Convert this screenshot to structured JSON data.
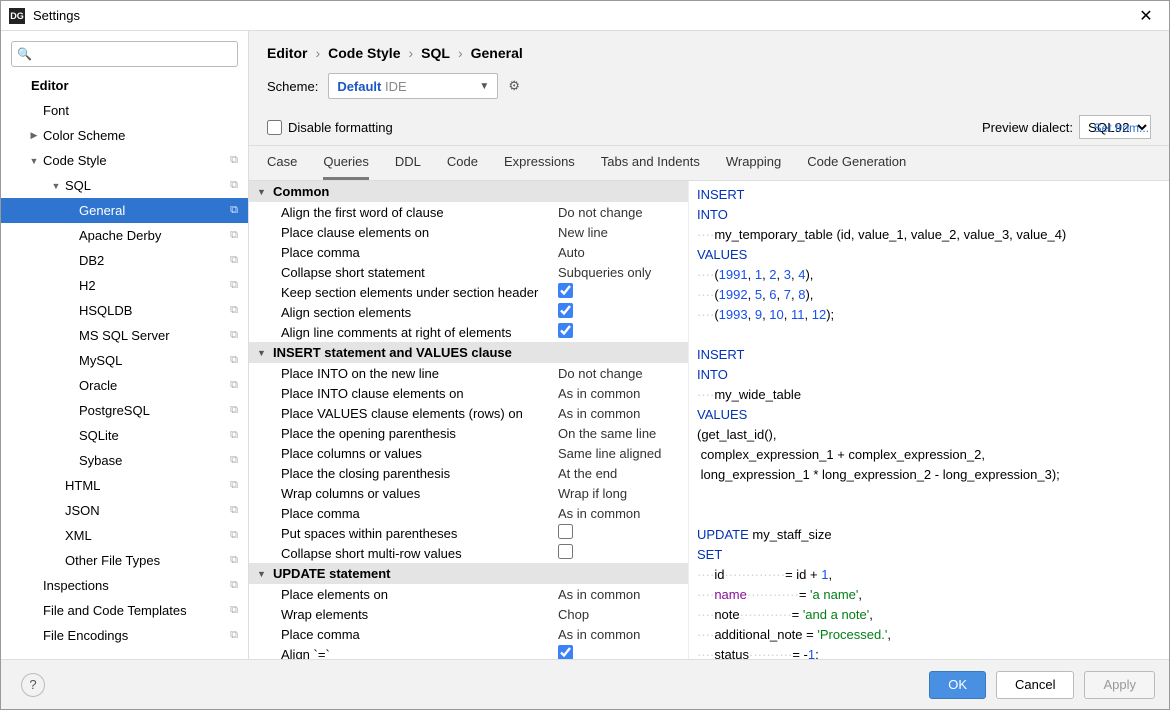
{
  "window": {
    "title": "Settings",
    "app_icon_text": "DG"
  },
  "search": {
    "placeholder": ""
  },
  "sidebar": {
    "heading": "Editor",
    "items": [
      {
        "label": "Font",
        "level": 1
      },
      {
        "label": "Color Scheme",
        "level": 1,
        "arrow": "▶"
      },
      {
        "label": "Code Style",
        "level": 1,
        "arrow": "▼",
        "copy": true
      },
      {
        "label": "SQL",
        "level": 2,
        "arrow": "▼",
        "copy": true
      },
      {
        "label": "General",
        "level": 3,
        "selected": true,
        "copy": true
      },
      {
        "label": "Apache Derby",
        "level": 3,
        "copy": true
      },
      {
        "label": "DB2",
        "level": 3,
        "copy": true
      },
      {
        "label": "H2",
        "level": 3,
        "copy": true
      },
      {
        "label": "HSQLDB",
        "level": 3,
        "copy": true
      },
      {
        "label": "MS SQL Server",
        "level": 3,
        "copy": true
      },
      {
        "label": "MySQL",
        "level": 3,
        "copy": true
      },
      {
        "label": "Oracle",
        "level": 3,
        "copy": true
      },
      {
        "label": "PostgreSQL",
        "level": 3,
        "copy": true
      },
      {
        "label": "SQLite",
        "level": 3,
        "copy": true
      },
      {
        "label": "Sybase",
        "level": 3,
        "copy": true
      },
      {
        "label": "HTML",
        "level": 2,
        "copy": true
      },
      {
        "label": "JSON",
        "level": 2,
        "copy": true
      },
      {
        "label": "XML",
        "level": 2,
        "copy": true
      },
      {
        "label": "Other File Types",
        "level": 2,
        "copy": true
      },
      {
        "label": "Inspections",
        "level": 1,
        "copy": true
      },
      {
        "label": "File and Code Templates",
        "level": 1,
        "copy": true
      },
      {
        "label": "File Encodings",
        "level": 1,
        "copy": true
      }
    ]
  },
  "breadcrumb": [
    "Editor",
    "Code Style",
    "SQL",
    "General"
  ],
  "scheme": {
    "label": "Scheme:",
    "value": "Default",
    "suffix": "IDE"
  },
  "set_from": "Set from...",
  "disable_formatting": {
    "label": "Disable formatting",
    "checked": false
  },
  "preview_dialect": {
    "label": "Preview dialect:",
    "value": "SQL92"
  },
  "tabs": [
    "Case",
    "Queries",
    "DDL",
    "Code",
    "Expressions",
    "Tabs and Indents",
    "Wrapping",
    "Code Generation"
  ],
  "active_tab": "Queries",
  "groups": [
    {
      "title": "Common",
      "rows": [
        {
          "label": "Align the first word of clause",
          "value": "Do not change"
        },
        {
          "label": "Place clause elements on",
          "value": "New line"
        },
        {
          "label": "Place comma",
          "value": "Auto"
        },
        {
          "label": "Collapse short statement",
          "value": "Subqueries only"
        },
        {
          "label": "Keep section elements under section header",
          "checkbox": true,
          "checked": true
        },
        {
          "label": "Align section elements",
          "checkbox": true,
          "checked": true
        },
        {
          "label": "Align line comments at right of elements",
          "checkbox": true,
          "checked": true
        }
      ]
    },
    {
      "title": "INSERT statement and VALUES clause",
      "rows": [
        {
          "label": "Place INTO on the new line",
          "value": "Do not change"
        },
        {
          "label": "Place INTO clause elements on",
          "value": "As in common"
        },
        {
          "label": "Place VALUES clause elements (rows) on",
          "value": "As in common"
        },
        {
          "label": "Place the opening parenthesis",
          "value": "On the same line"
        },
        {
          "label": "Place columns or values",
          "value": "Same line aligned"
        },
        {
          "label": "Place the closing parenthesis",
          "value": "At the end"
        },
        {
          "label": "Wrap columns or values",
          "value": "Wrap if long"
        },
        {
          "label": "Place comma",
          "value": "As in common"
        },
        {
          "label": "Put spaces within parentheses",
          "checkbox": true,
          "checked": false
        },
        {
          "label": "Collapse short multi-row values",
          "checkbox": true,
          "checked": false
        }
      ]
    },
    {
      "title": "UPDATE statement",
      "rows": [
        {
          "label": "Place elements on",
          "value": "As in common"
        },
        {
          "label": "Wrap elements",
          "value": "Chop"
        },
        {
          "label": "Place comma",
          "value": "As in common"
        },
        {
          "label": "Align `=`",
          "checkbox": true,
          "checked": true
        }
      ]
    }
  ],
  "preview_code": [
    [
      [
        "kw",
        "INSERT"
      ]
    ],
    [
      [
        "kw",
        "INTO"
      ]
    ],
    [
      [
        "ws",
        "····"
      ],
      [
        "",
        "my_temporary_table (id, value_1, value_2, value_3, value_4)"
      ]
    ],
    [
      [
        "kw",
        "VALUES"
      ]
    ],
    [
      [
        "ws",
        "····"
      ],
      [
        "",
        "("
      ],
      [
        "num",
        "1991"
      ],
      [
        "",
        ", "
      ],
      [
        "num",
        "1"
      ],
      [
        "",
        ", "
      ],
      [
        "num",
        "2"
      ],
      [
        "",
        ", "
      ],
      [
        "num",
        "3"
      ],
      [
        "",
        ", "
      ],
      [
        "num",
        "4"
      ],
      [
        "",
        "),"
      ]
    ],
    [
      [
        "ws",
        "····"
      ],
      [
        "",
        "("
      ],
      [
        "num",
        "1992"
      ],
      [
        "",
        ", "
      ],
      [
        "num",
        "5"
      ],
      [
        "",
        ", "
      ],
      [
        "num",
        "6"
      ],
      [
        "",
        ", "
      ],
      [
        "num",
        "7"
      ],
      [
        "",
        ", "
      ],
      [
        "num",
        "8"
      ],
      [
        "",
        "),"
      ]
    ],
    [
      [
        "ws",
        "····"
      ],
      [
        "",
        "("
      ],
      [
        "num",
        "1993"
      ],
      [
        "",
        ", "
      ],
      [
        "num",
        "9"
      ],
      [
        "",
        ", "
      ],
      [
        "num",
        "10"
      ],
      [
        "",
        ", "
      ],
      [
        "num",
        "11"
      ],
      [
        "",
        ", "
      ],
      [
        "num",
        "12"
      ],
      [
        "",
        ");"
      ]
    ],
    [
      [
        "",
        ""
      ]
    ],
    [
      [
        "kw",
        "INSERT"
      ]
    ],
    [
      [
        "kw",
        "INTO"
      ]
    ],
    [
      [
        "ws",
        "····"
      ],
      [
        "",
        "my_wide_table"
      ]
    ],
    [
      [
        "kw",
        "VALUES"
      ]
    ],
    [
      [
        "",
        "(get_last_id(),"
      ]
    ],
    [
      [
        "",
        " complex_expression_1 + complex_expression_2,"
      ]
    ],
    [
      [
        "",
        " long_expression_1 * long_expression_2 - long_expression_3);"
      ]
    ],
    [
      [
        "",
        ""
      ]
    ],
    [
      [
        "",
        ""
      ]
    ],
    [
      [
        "kw",
        "UPDATE"
      ],
      [
        "",
        " my_staff_size"
      ]
    ],
    [
      [
        "kw",
        "SET"
      ]
    ],
    [
      [
        "ws",
        "····"
      ],
      [
        "",
        "id"
      ],
      [
        "ws",
        "··············"
      ],
      [
        "",
        "= id + "
      ],
      [
        "num",
        "1"
      ],
      [
        "",
        ","
      ]
    ],
    [
      [
        "ws",
        "····"
      ],
      [
        "ident",
        "name"
      ],
      [
        "ws",
        "············"
      ],
      [
        "",
        "= "
      ],
      [
        "str",
        "'a name'"
      ],
      [
        "",
        ","
      ]
    ],
    [
      [
        "ws",
        "····"
      ],
      [
        "",
        "note"
      ],
      [
        "ws",
        "············"
      ],
      [
        "",
        "= "
      ],
      [
        "str",
        "'and a note'"
      ],
      [
        "",
        ","
      ]
    ],
    [
      [
        "ws",
        "····"
      ],
      [
        "",
        "additional_note = "
      ],
      [
        "str",
        "'Processed.'"
      ],
      [
        "",
        ","
      ]
    ],
    [
      [
        "ws",
        "····"
      ],
      [
        "",
        "status"
      ],
      [
        "ws",
        "··········"
      ],
      [
        "",
        "= -"
      ],
      [
        "num",
        "1"
      ],
      [
        "",
        ";"
      ]
    ]
  ],
  "footer": {
    "ok": "OK",
    "cancel": "Cancel",
    "apply": "Apply"
  }
}
